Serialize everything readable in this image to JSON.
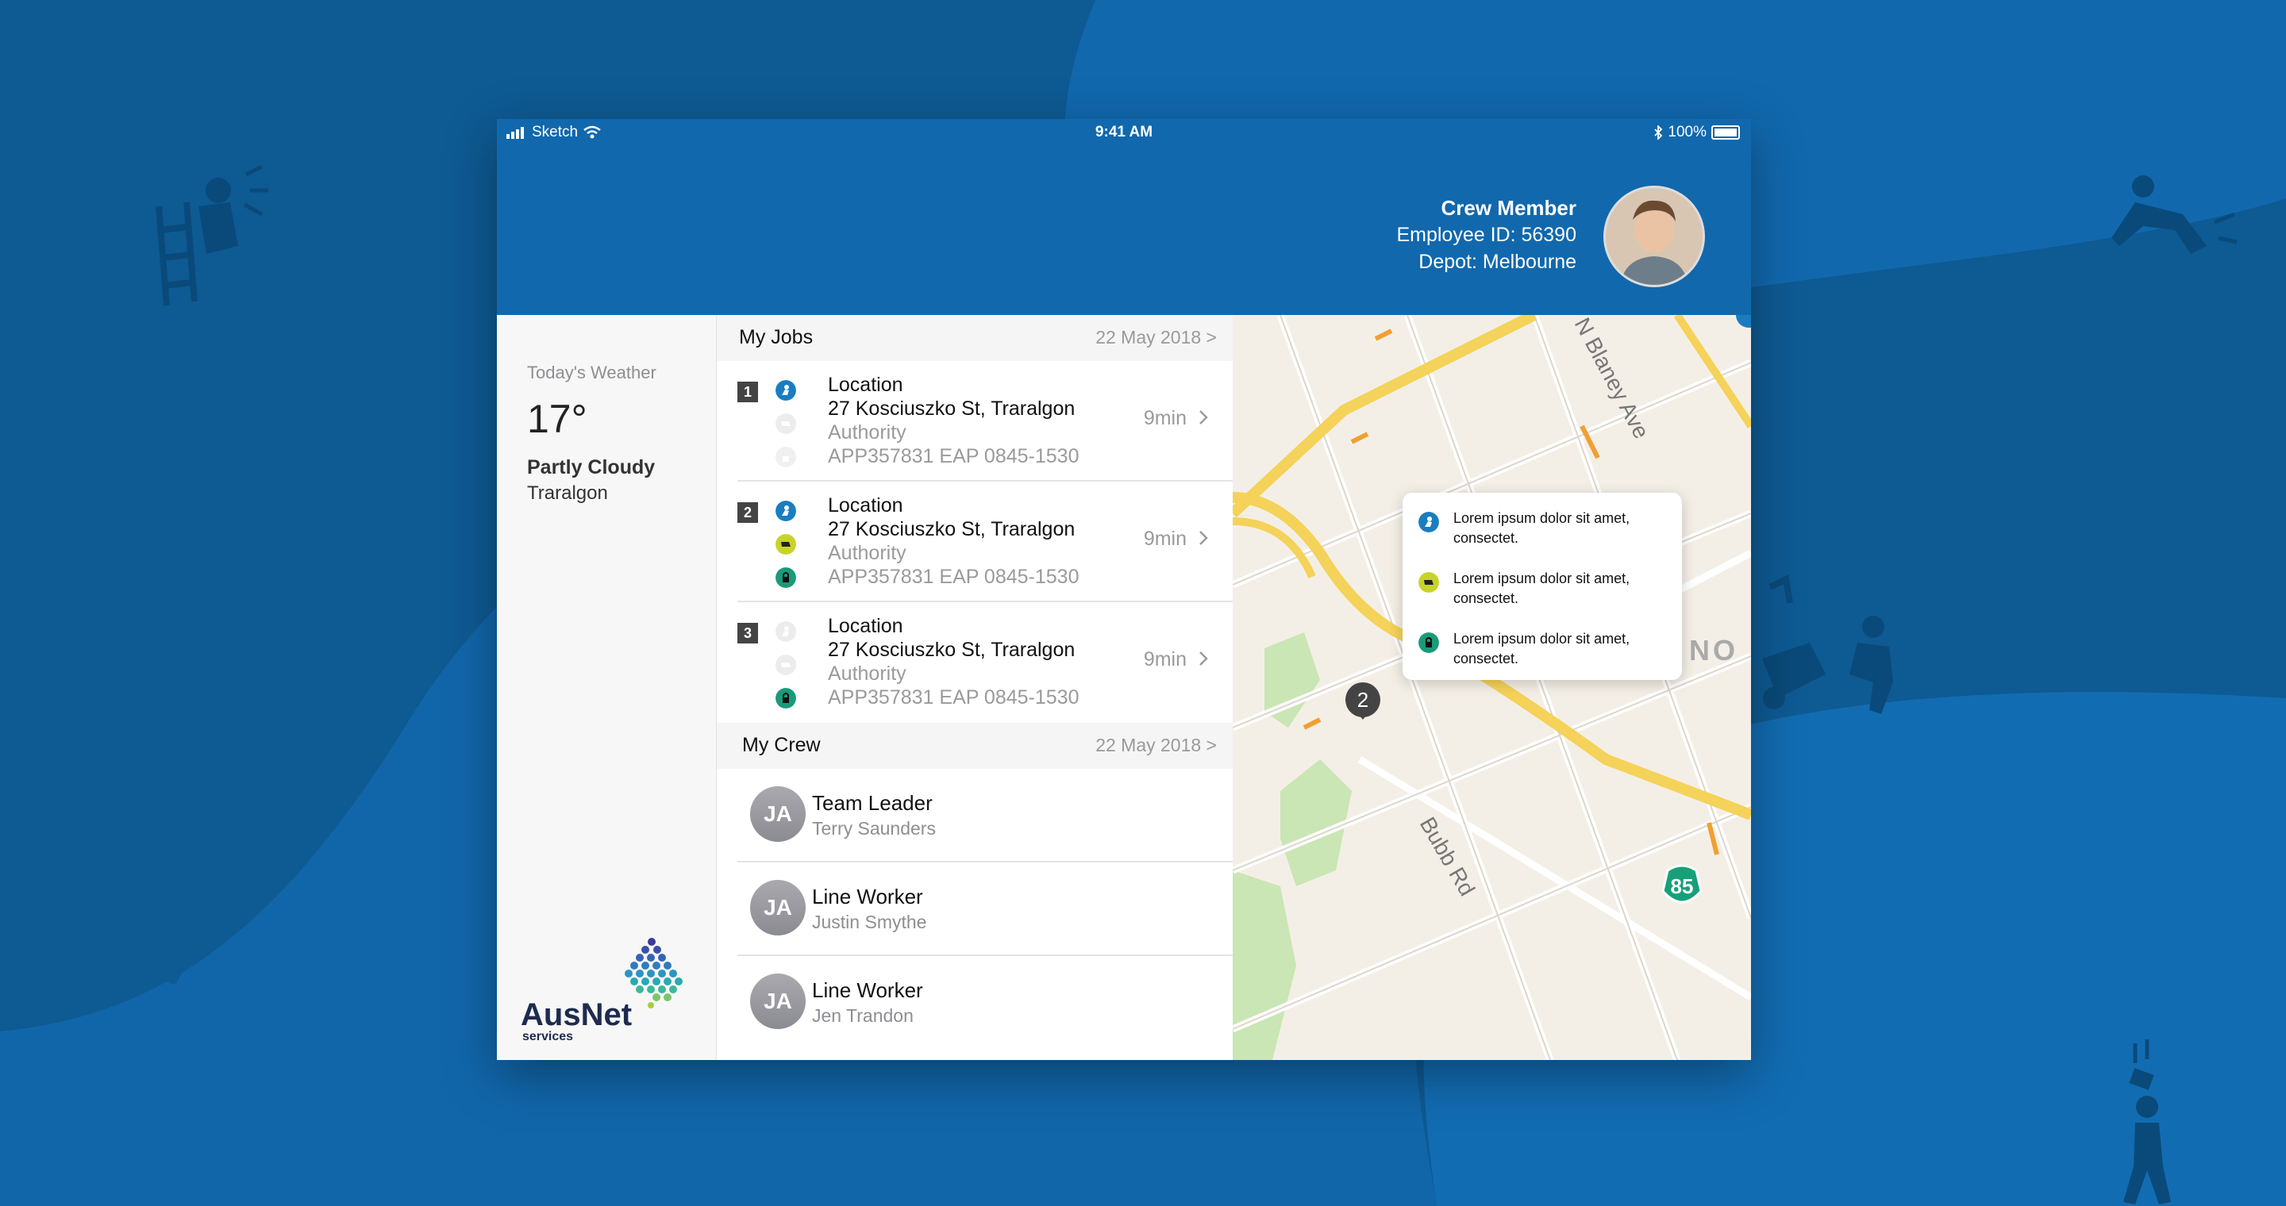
{
  "status_bar": {
    "carrier": "Sketch",
    "time": "9:41 AM",
    "battery": "100%"
  },
  "profile": {
    "role": "Crew Member",
    "employee_id": "Employee ID: 56390",
    "depot": "Depot: Melbourne"
  },
  "weather": {
    "label": "Today's Weather",
    "temp": "17°",
    "condition": "Partly Cloudy",
    "city": "Traralgon"
  },
  "brand": {
    "name": "AusNet",
    "sub": "services"
  },
  "jobs": {
    "title": "My Jobs",
    "date": "22 May 2018 >",
    "items": [
      {
        "num": "1",
        "title": "Location",
        "address": "27 Kosciuszko St, Traralgon",
        "authority": "Authority",
        "app": "APP357831 EAP 0845-1530",
        "eta": "9min"
      },
      {
        "num": "2",
        "title": "Location",
        "address": "27 Kosciuszko St, Traralgon",
        "authority": "Authority",
        "app": "APP357831 EAP 0845-1530",
        "eta": "9min"
      },
      {
        "num": "3",
        "title": "Location",
        "address": "27 Kosciuszko St, Traralgon",
        "authority": "Authority",
        "app": "APP357831 EAP 0845-1530",
        "eta": "9min"
      }
    ]
  },
  "crew": {
    "title": "My Crew",
    "date": "22 May 2018 >",
    "members": [
      {
        "initials": "JA",
        "role": "Team Leader",
        "name": "Terry Saunders"
      },
      {
        "initials": "JA",
        "role": "Line Worker",
        "name": "Justin Smythe"
      },
      {
        "initials": "JA",
        "role": "Line Worker",
        "name": "Jen Trandon"
      }
    ]
  },
  "map": {
    "street_1": "N Blaney Ave",
    "street_2": "Bubb Rd",
    "partial_label": "NO",
    "marker": "2",
    "highway": "85",
    "popup": [
      {
        "icon": "worker-icon",
        "text": "Lorem ipsum dolor sit amet, consectet."
      },
      {
        "icon": "dog-icon",
        "text": "Lorem ipsum dolor sit amet, consectet."
      },
      {
        "icon": "lock-icon",
        "text": "Lorem ipsum dolor sit amet, consectet."
      }
    ]
  },
  "colors": {
    "header_blue": "#1168ad",
    "bg_dark": "#0e5a93",
    "icon_blue": "#1a7dc0",
    "icon_yellow": "#c8d32a",
    "icon_green": "#1a9a78"
  }
}
